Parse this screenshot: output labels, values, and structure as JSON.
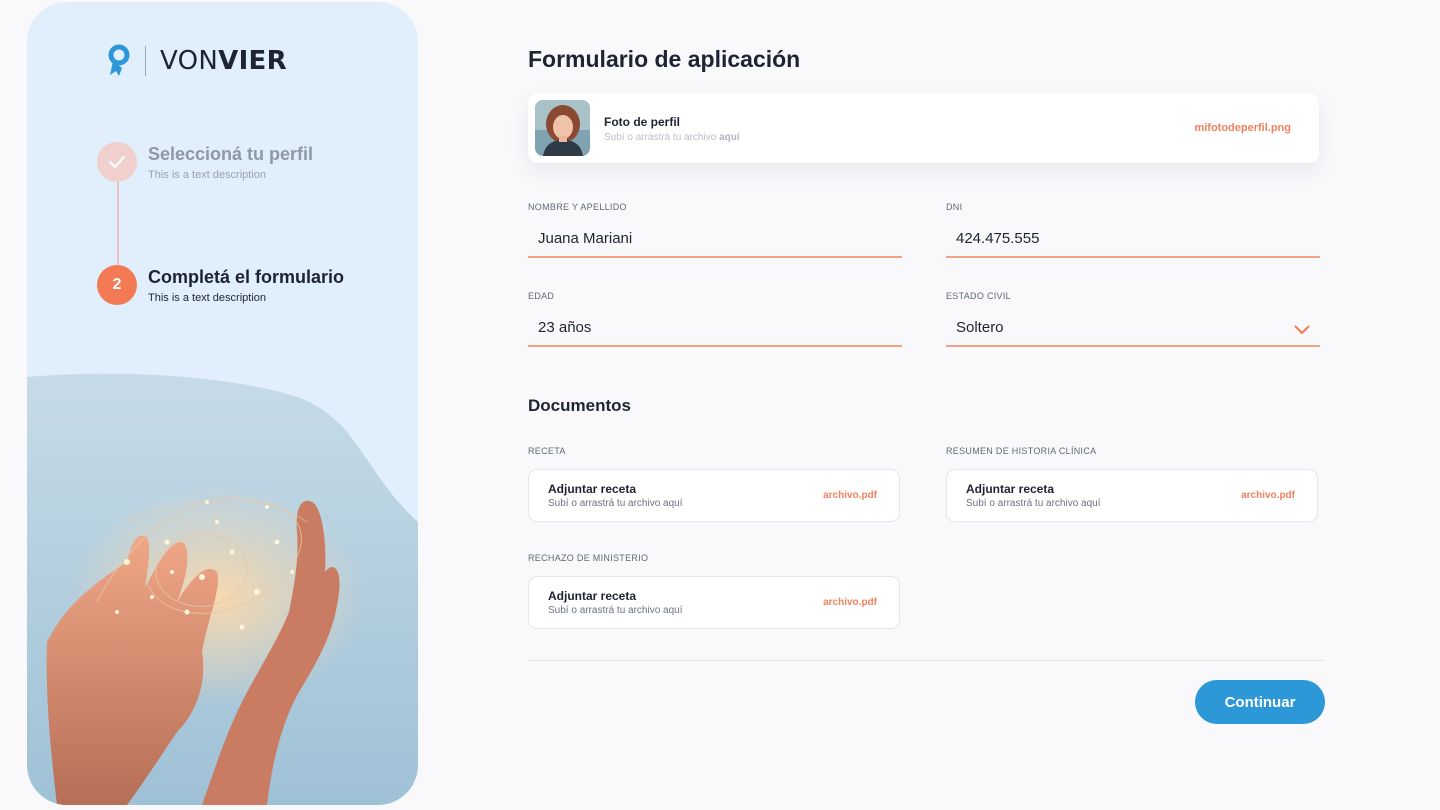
{
  "brand": {
    "name_light": "VON",
    "name_bold": "VIER",
    "logo_icon": "ribbon-pin-icon",
    "accent": "#2c98d8"
  },
  "steps": [
    {
      "label": "Seleccioná tu perfil",
      "description": "This is a text description",
      "state": "done",
      "icon": "check-icon"
    },
    {
      "number": "2",
      "label": "Completá el formulario",
      "description": "This is a text description",
      "state": "active"
    }
  ],
  "form": {
    "title": "Formulario de aplicación",
    "photo": {
      "label": "Foto de perfil",
      "hint_prefix": "Subí o arrastrá tu archivo ",
      "hint_bold": "aquí",
      "filename": "mifotodeperfil.png"
    },
    "fields": {
      "name": {
        "label": "NOMBRE Y APELLIDO",
        "value": "Juana Mariani"
      },
      "dni": {
        "label": "DNI",
        "value": "424.475.555"
      },
      "age": {
        "label": "EDAD",
        "value": "23 años"
      },
      "civil": {
        "label": "ESTADO CIVIL",
        "value": "Soltero"
      }
    }
  },
  "documents": {
    "title": "Documentos",
    "items": [
      {
        "label": "RECETA",
        "title": "Adjuntar receta",
        "hint": "Subí o arrastrá tu archivo aquí",
        "file": "archivo.pdf"
      },
      {
        "label": "RESUMEN DE HISTORIA CLÍNICA",
        "title": "Adjuntar receta",
        "hint": "Subí o arrastrá tu archivo aquí",
        "file": "archivo.pdf"
      },
      {
        "label": "RECHAZO DE MINISTERIO",
        "title": "Adjuntar receta",
        "hint": "Subí o arrastrá tu archivo aquí",
        "file": "archivo.pdf"
      }
    ]
  },
  "actions": {
    "continue_label": "Continuar"
  },
  "colors": {
    "accent_orange": "#f47a55",
    "field_underline": "#f3a286",
    "button_blue": "#2c98d8",
    "sidebar_bg": "#e1eefb"
  }
}
